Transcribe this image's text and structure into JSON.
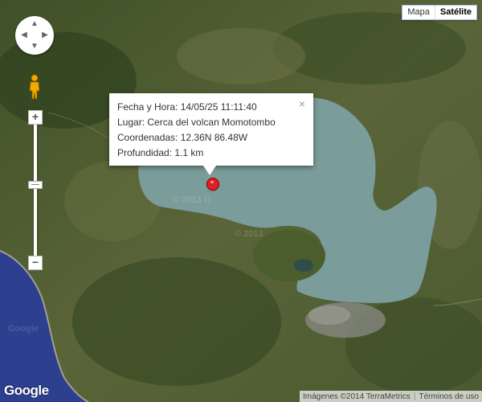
{
  "map": {
    "type": "satellite",
    "map_types": [
      {
        "label": "Mapa",
        "active": false
      },
      {
        "label": "Satélite",
        "active": true
      }
    ],
    "info_window": {
      "lines": [
        "Fecha y Hora: 14/05/25 11:11:40",
        "Lugar: Cerca del volcan Momotombo",
        "Coordenadas: 12.36N 86.48W",
        "Profundidad: 1.1 km"
      ],
      "close": "×"
    },
    "controls": {
      "pan_up": "▲",
      "pan_down": "▼",
      "pan_left": "◀",
      "pan_right": "▶",
      "zoom_in": "+",
      "zoom_out": "−"
    },
    "logo": "Google",
    "footer": {
      "imagery": "Imágenes ©2014 TerraMetrics",
      "terms": "Términos de uso"
    },
    "watermarks": [
      "© 2013 G",
      "© 2013",
      "Google"
    ],
    "colors": {
      "land": "#4c5a31",
      "lake": "#7a9c9a",
      "ocean": "#2d3f8f",
      "marker": "#e02020"
    }
  }
}
